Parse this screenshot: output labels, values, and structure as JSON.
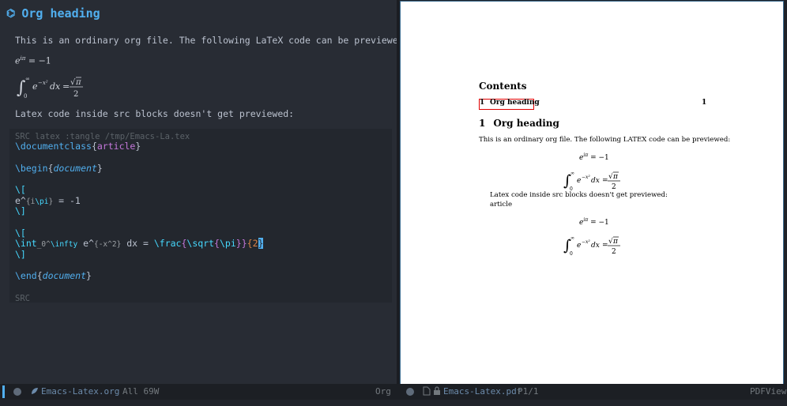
{
  "org_buffer": {
    "heading": "Org heading",
    "heading_bullet": "⌬",
    "paragraph": "This is an ordinary org file. The following LaTeX code can be previewed:",
    "note": "Latex code inside src blocks doesn't get previewed:",
    "src_block": {
      "header": "SRC latex :tangle /tmp/Emacs-La.tex",
      "footer": "SRC",
      "lines": {
        "documentclass_cmd": "\\documentclass",
        "documentclass_arg": "article",
        "begin_cmd": "\\begin",
        "begin_arg": "document",
        "math_open_1": "\\[",
        "euler_line_start": "e^",
        "euler_open": "{",
        "euler_i": "i",
        "euler_pi": "\\pi",
        "euler_close": "}",
        "euler_rest": " = -1",
        "math_close_1": "\\]",
        "math_open_2": "\\[",
        "int_cmd": "\\int",
        "int_sub": "_0^",
        "int_infty": "\\infty",
        "int_exp_start": " e^",
        "int_exp": "{-x^2}",
        "int_dx": " dx = ",
        "frac_cmd": "\\frac",
        "frac_open": "{",
        "sqrt_cmd": "\\sqrt",
        "sqrt_open": "{",
        "sqrt_pi": "\\pi",
        "sqrt_close": "}}",
        "frac_open2": "{",
        "frac_two": "2",
        "frac_close2": "}",
        "math_close_2": "\\]",
        "end_cmd": "\\end",
        "end_arg": "document"
      }
    }
  },
  "pdf": {
    "contents_title": "Contents",
    "toc_entry_num": "1",
    "toc_entry_label": "Org heading",
    "toc_entry_page": "1",
    "section_num": "1",
    "section_title": "Org heading",
    "paragraph_before": "This is an ordinary org file. The following ",
    "latex_logo": "LATEX",
    "paragraph_after": " code can be previewed:",
    "note_line": "Latex code inside src blocks doesn't get previewed:",
    "article_word": "article"
  },
  "modeline": {
    "left_filename": "Emacs-Latex.org",
    "left_position": "All 69W",
    "left_mode": "Org",
    "right_filename": "Emacs-Latex.pdf",
    "right_page": "P1/1",
    "right_mode": "PDFView"
  }
}
